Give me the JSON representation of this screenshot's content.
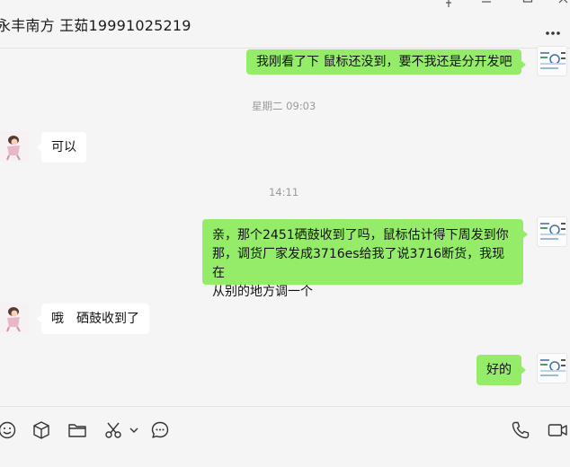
{
  "header": {
    "title": "永丰南方 王茹19991025219"
  },
  "messages": [
    {
      "type": "outgoing",
      "text": "我刚看了下 鼠标还没到，要不我还是分开发吧"
    },
    {
      "type": "timestamp",
      "text": "星期二 09:03"
    },
    {
      "type": "incoming",
      "text": "可以"
    },
    {
      "type": "timestamp",
      "text": "14:11"
    },
    {
      "type": "outgoing",
      "lines": [
        "亲，那个2451硒鼓收到了吗，鼠标估计得下周发到你",
        "那，调货厂家发成3716es给我了说3716断货，我现在",
        "从别的地方调一个"
      ]
    },
    {
      "type": "incoming",
      "text": "哦　硒鼓收到了"
    },
    {
      "type": "outgoing",
      "text": "好的"
    }
  ],
  "toolbar": {
    "icons": [
      "emoji-icon",
      "sticker-box-icon",
      "folder-icon",
      "scissors-icon",
      "chevron-down-icon",
      "chat-history-icon",
      "phone-icon",
      "video-call-icon"
    ]
  },
  "colors": {
    "outgoing_bubble": "#95ec69",
    "incoming_bubble": "#ffffff",
    "background": "#f5f5f5"
  }
}
